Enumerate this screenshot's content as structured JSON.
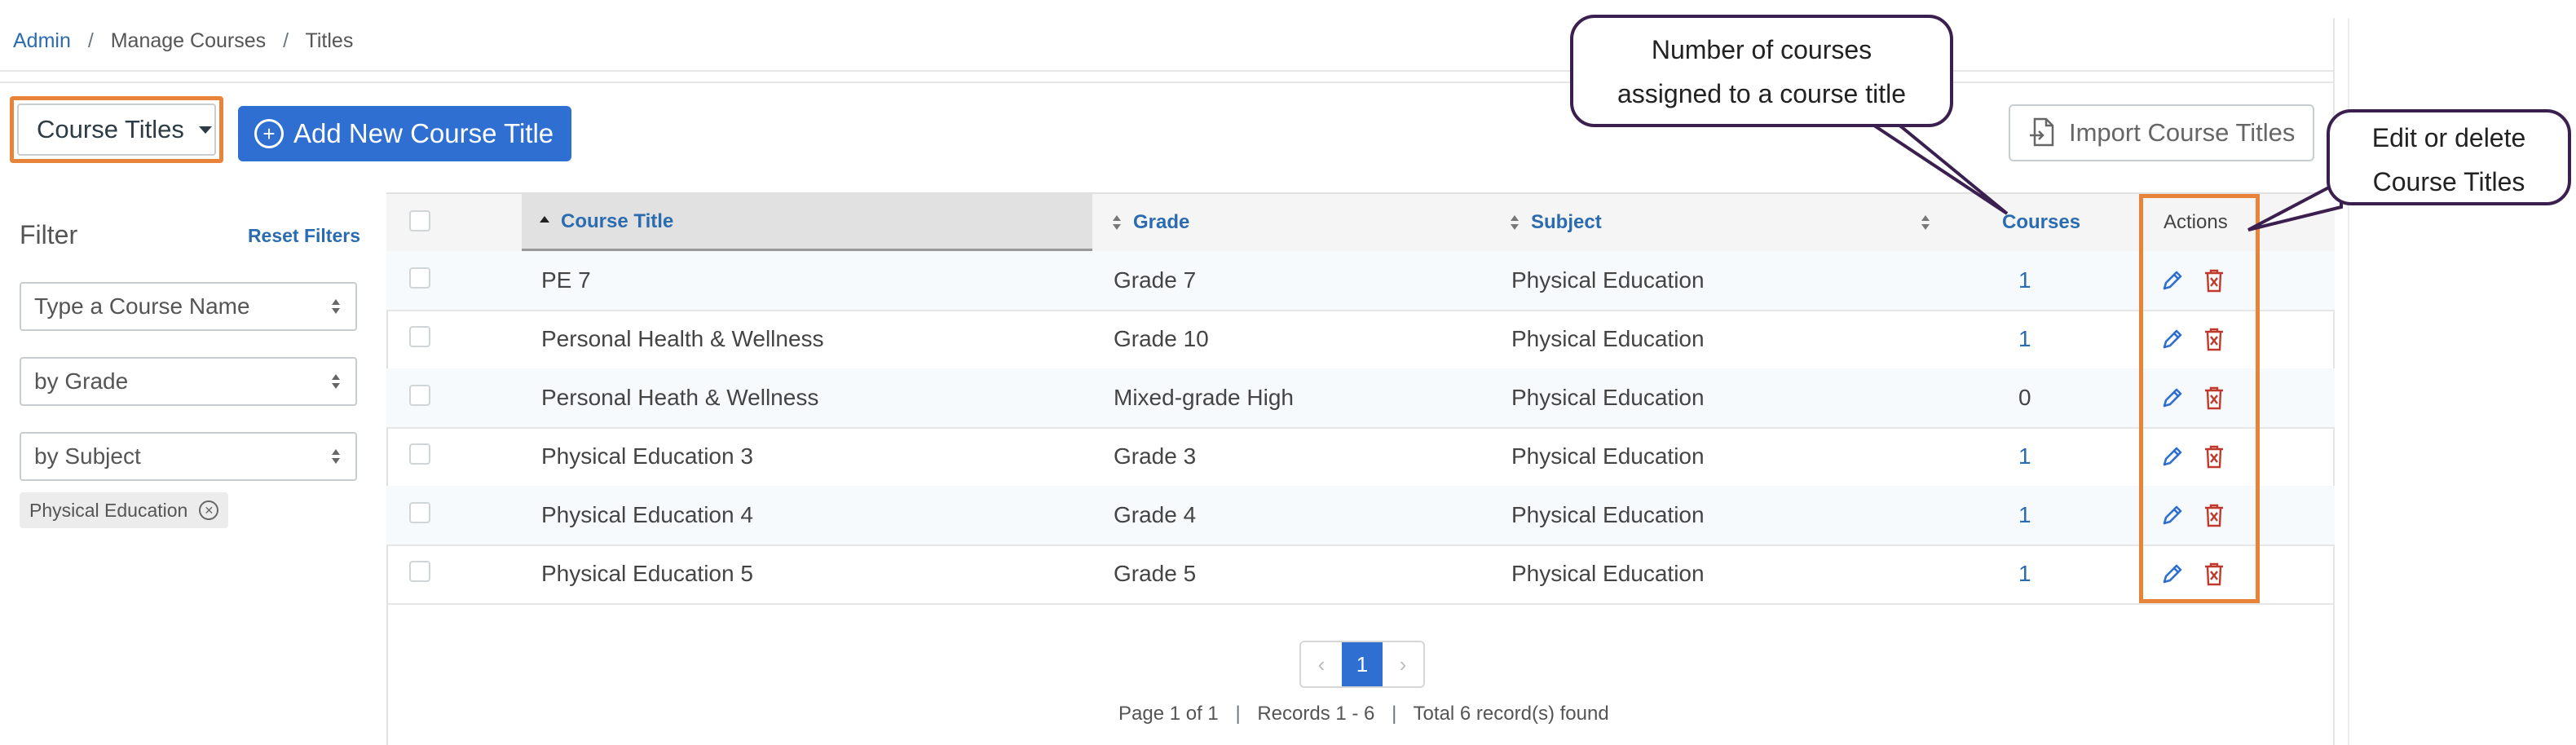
{
  "breadcrumb": {
    "admin": "Admin",
    "manage": "Manage Courses",
    "titles": "Titles",
    "sep": "/"
  },
  "toolbar": {
    "dropdown_label": "Course Titles",
    "add_label": "Add New Course Title",
    "import_label": "Import Course Titles"
  },
  "filter": {
    "title": "Filter",
    "reset": "Reset Filters",
    "course_placeholder": "Type a Course Name",
    "grade": "by Grade",
    "subject": "by Subject",
    "chip": "Physical Education"
  },
  "table": {
    "headers": {
      "title": "Course Title",
      "grade": "Grade",
      "subject": "Subject",
      "courses": "Courses",
      "actions": "Actions"
    },
    "rows": [
      {
        "title": "PE 7",
        "grade": "Grade 7",
        "subject": "Physical Education",
        "courses": "1"
      },
      {
        "title": "Personal Health & Wellness",
        "grade": "Grade 10",
        "subject": "Physical Education",
        "courses": "1"
      },
      {
        "title": "Personal Heath & Wellness",
        "grade": "Mixed-grade High",
        "subject": "Physical Education",
        "courses": "0"
      },
      {
        "title": "Physical Education 3",
        "grade": "Grade 3",
        "subject": "Physical Education",
        "courses": "1"
      },
      {
        "title": "Physical Education 4",
        "grade": "Grade 4",
        "subject": "Physical Education",
        "courses": "1"
      },
      {
        "title": "Physical Education 5",
        "grade": "Grade 5",
        "subject": "Physical Education",
        "courses": "1"
      }
    ]
  },
  "pager": {
    "current": "1",
    "prev": "‹",
    "next": "›"
  },
  "pageinfo": {
    "page": "Page 1 of 1",
    "records": "Records 1 - 6",
    "total": "Total 6 record(s) found",
    "sep": "|"
  },
  "callouts": {
    "courses_line1": "Number of courses",
    "courses_line2": "assigned to a course title",
    "actions_line1": "Edit or delete",
    "actions_line2": "Course Titles"
  },
  "colors": {
    "accent": "#2f6fd1",
    "highlight": "#e8833a",
    "callout_border": "#3b1f4f",
    "delete": "#c0392b"
  },
  "icons": {
    "edit": "pencil-icon",
    "delete": "trash-icon",
    "import": "file-import-icon",
    "add": "plus-circle-icon"
  }
}
